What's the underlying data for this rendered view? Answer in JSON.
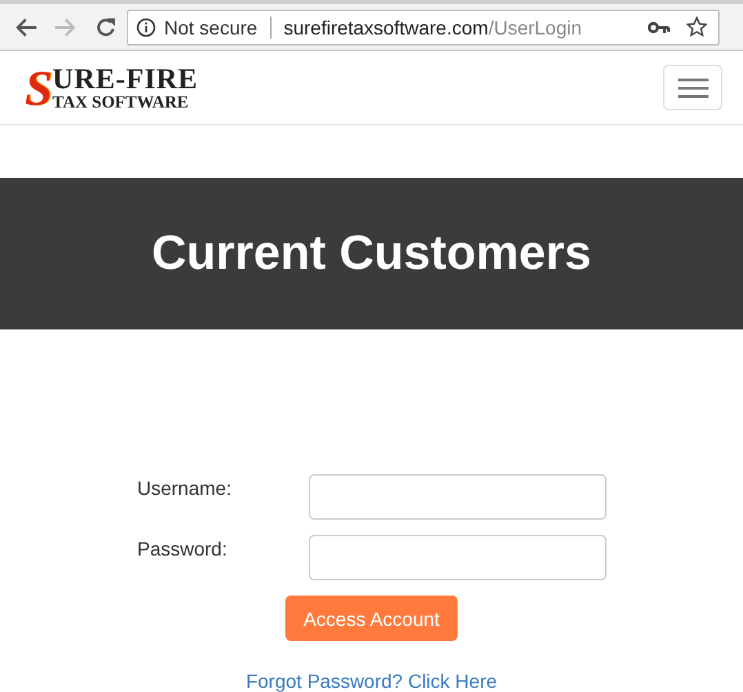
{
  "browser": {
    "security": "Not secure",
    "url_host": "surefiretaxsoftware.com",
    "url_path": "/UserLogin"
  },
  "logo": {
    "initial": "S",
    "name": "URE-FIRE",
    "tagline": "TAX SOFTWARE"
  },
  "hero": {
    "title": "Current Customers"
  },
  "form": {
    "fields": [
      {
        "label": "Username:"
      },
      {
        "label": "Password:"
      }
    ],
    "submit": "Access Account",
    "forgot_link": "Forgot Password? Click Here"
  }
}
